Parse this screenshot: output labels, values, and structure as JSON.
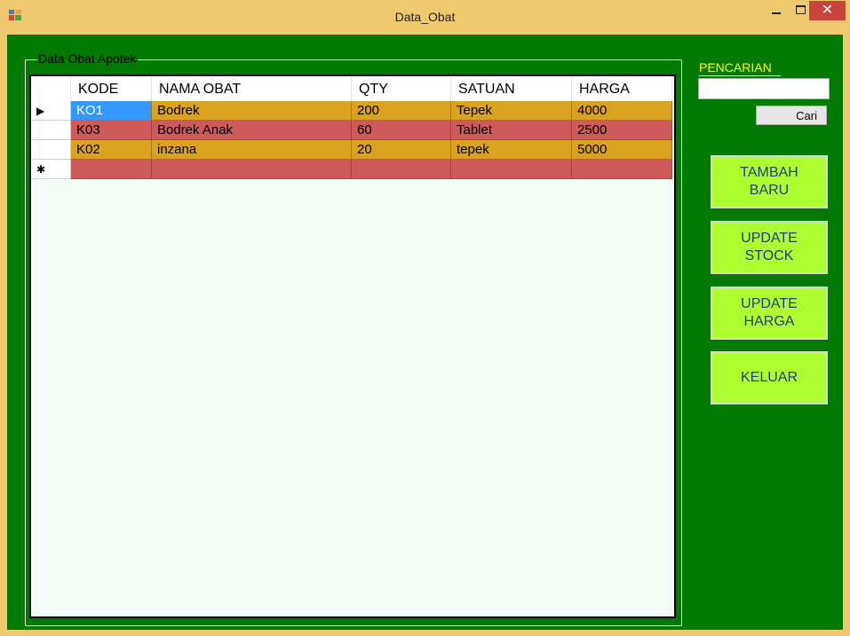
{
  "window": {
    "title": "Data_Obat",
    "icons": {
      "app": "form-app-icon",
      "minimize": "minimize-icon",
      "maximize": "maximize-icon",
      "close": "close-icon"
    },
    "close_glyph": "✕"
  },
  "group": {
    "caption": "Data Obat Apotek"
  },
  "table": {
    "columns": [
      "KODE",
      "NAMA OBAT",
      "QTY",
      "SATUAN",
      "HARGA"
    ],
    "rows": [
      {
        "marker": "▶",
        "cells": [
          "KO1",
          "Bodrek",
          "200",
          "Tepek",
          "4000"
        ]
      },
      {
        "marker": "",
        "cells": [
          "K03",
          "Bodrek Anak",
          "60",
          "Tablet",
          "2500"
        ]
      },
      {
        "marker": "",
        "cells": [
          "K02",
          "inzana",
          "20",
          "tepek",
          "5000"
        ]
      },
      {
        "marker": "✱",
        "cells": [
          "",
          "",
          "",
          "",
          ""
        ]
      }
    ],
    "row_colors": {
      "odd": "#d9a21f",
      "even": "#cd5b59",
      "selected": "#3399ff"
    }
  },
  "search": {
    "label": "PENCARIAN",
    "value": "",
    "button": "Cari"
  },
  "actions": {
    "tambah": "TAMBAH\nBARU",
    "update_stock": "UPDATE\nSTOCK",
    "update_harga": "UPDATE\nHARGA",
    "keluar": "KELUAR"
  },
  "colors": {
    "background": "#007a00",
    "titlebar": "#f0c96e",
    "button": "#adff2f",
    "label": "#ffff00"
  }
}
